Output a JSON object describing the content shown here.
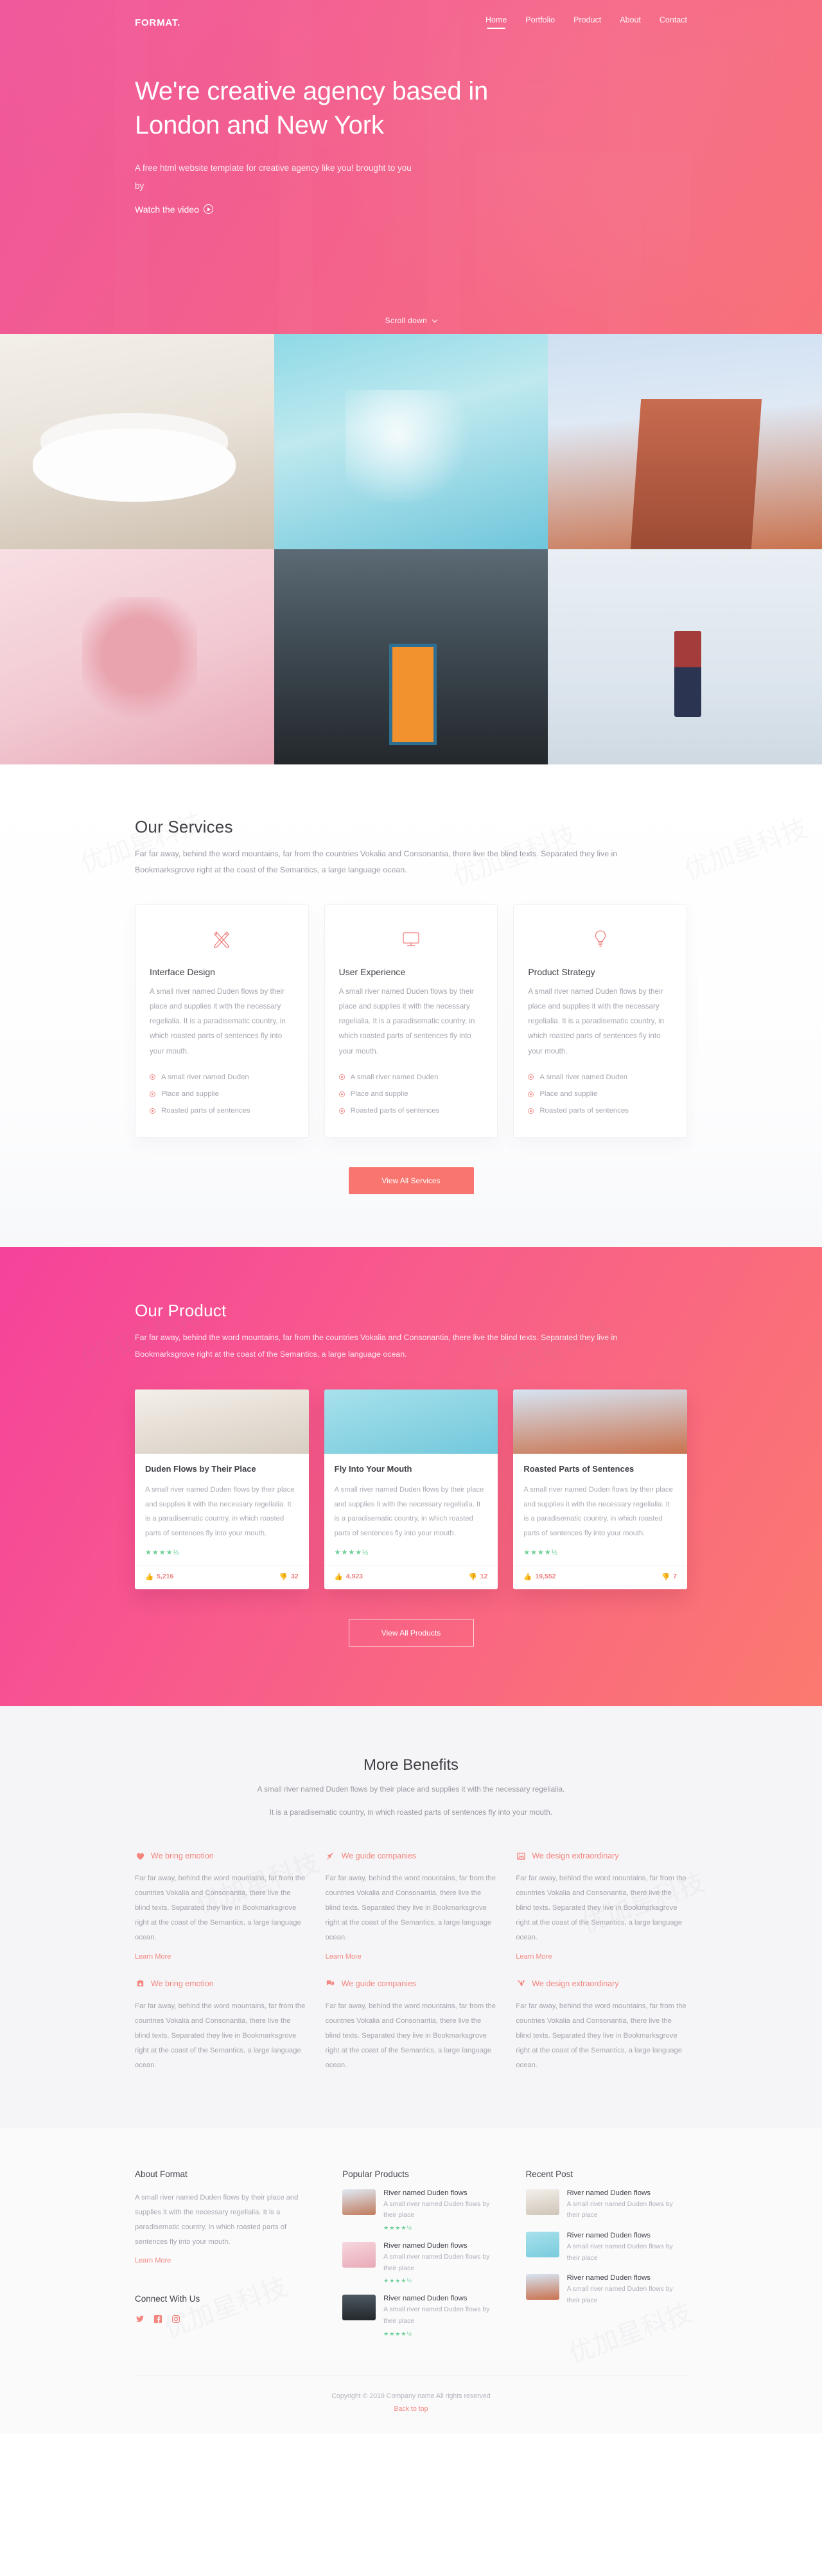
{
  "brand": "FORMAT.",
  "nav": {
    "items": [
      {
        "label": "Home",
        "active": true
      },
      {
        "label": "Portfolio",
        "active": false
      },
      {
        "label": "Product",
        "active": false
      },
      {
        "label": "About",
        "active": false
      },
      {
        "label": "Contact",
        "active": false
      }
    ]
  },
  "hero": {
    "title": "We're creative agency based in London and New York",
    "subtitle": "A free html website template for creative agency like you! brought to you by",
    "watch_label": "Watch the video",
    "scroll_label": "Scroll down"
  },
  "services": {
    "title": "Our Services",
    "lead": "Far far away, behind the word mountains, far from the countries Vokalia and Consonantia, there live the blind texts. Separated they live in Bookmarksgrove right at the coast of the Semantics, a large language ocean.",
    "cards": [
      {
        "icon": "pencil-ruler-icon",
        "title": "Interface Design",
        "body": "A small river named Duden flows by their place and supplies it with the necessary regelialia. It is a paradisematic country, in which roasted parts of sentences fly into your mouth.",
        "items": [
          "A small river named Duden",
          "Place and supplie",
          "Roasted parts of sentences"
        ]
      },
      {
        "icon": "monitor-icon",
        "title": "User Experience",
        "body": "A small river named Duden flows by their place and supplies it with the necessary regelialia. It is a paradisematic country, in which roasted parts of sentences fly into your mouth.",
        "items": [
          "A small river named Duden",
          "Place and supplie",
          "Roasted parts of sentences"
        ]
      },
      {
        "icon": "lightbulb-icon",
        "title": "Product Strategy",
        "body": "A small river named Duden flows by their place and supplies it with the necessary regelialia. It is a paradisematic country, in which roasted parts of sentences fly into your mouth.",
        "items": [
          "A small river named Duden",
          "Place and supplie",
          "Roasted parts of sentences"
        ]
      }
    ],
    "button": "View All Services"
  },
  "product": {
    "title": "Our Product",
    "lead": "Far far away, behind the word mountains, far from the countries Vokalia and Consonantia, there live the blind texts. Separated they live in Bookmarksgrove right at the coast of the Semantics, a large language ocean.",
    "cards": [
      {
        "image": "dining-room-photo",
        "title": "Duden Flows by Their Place",
        "body": "A small river named Duden flows by their place and supplies it with the necessary regelialia. It is a paradisematic country, in which roasted parts of sentences fly into your mouth.",
        "rating": "★★★★½",
        "likes": "5,216",
        "dislikes": "32"
      },
      {
        "image": "swimming-pool-photo",
        "title": "Fly Into Your Mouth",
        "body": "A small river named Duden flows by their place and supplies it with the necessary regelialia. It is a paradisematic country, in which roasted parts of sentences fly into your mouth.",
        "rating": "★★★★½",
        "likes": "4,923",
        "dislikes": "12"
      },
      {
        "image": "brick-building-photo",
        "title": "Roasted Parts of Sentences",
        "body": "A small river named Duden flows by their place and supplies it with the necessary regelialia. It is a paradisematic country, in which roasted parts of sentences fly into your mouth.",
        "rating": "★★★★½",
        "likes": "19,552",
        "dislikes": "7"
      }
    ],
    "button": "View All Products"
  },
  "benefits": {
    "title": "More Benefits",
    "lead_line1": "A small river named Duden flows by their place and supplies it with the necessary regelialia.",
    "lead_line2": "It is a paradisematic country, in which roasted parts of sentences fly into your mouth.",
    "body": "Far far away, behind the word mountains, far from the countries Vokalia and Consonantia, there live the blind texts. Separated they live in Bookmarksgrove right at the coast of the Semantics, a large language ocean.",
    "learn_more": "Learn More",
    "items": [
      {
        "icon": "heart-icon",
        "title": "We bring emotion"
      },
      {
        "icon": "rocket-icon",
        "title": "We guide companies"
      },
      {
        "icon": "image-icon",
        "title": "We design extraordinary"
      },
      {
        "icon": "briefcase-medical-icon",
        "title": "We bring emotion"
      },
      {
        "icon": "chat-bubbles-icon",
        "title": "We guide companies"
      },
      {
        "icon": "shield-icon",
        "title": "We design extraordinary"
      }
    ]
  },
  "footer": {
    "about": {
      "title": "About Format",
      "body": "A small river named Duden flows by their place and supplies it with the necessary regelialia. It is a paradisematic country, in which roasted parts of sentences fly into your mouth.",
      "learn_more": "Learn More"
    },
    "connect": {
      "title": "Connect With Us",
      "socials": [
        {
          "icon": "twitter-icon",
          "label": "Twitter"
        },
        {
          "icon": "facebook-icon",
          "label": "Facebook"
        },
        {
          "icon": "instagram-icon",
          "label": "Instagram"
        }
      ]
    },
    "popular": {
      "title": "Popular Products",
      "items": [
        {
          "image": "brick-building-thumb",
          "title": "River named Duden flows",
          "body": "A small river named Duden flows by their place",
          "rating": "★★★★½"
        },
        {
          "image": "pink-portrait-thumb",
          "title": "River named Duden flows",
          "body": "A small river named Duden flows by their place",
          "rating": "★★★★½"
        },
        {
          "image": "cabin-door-thumb",
          "title": "River named Duden flows",
          "body": "A small river named Duden flows by their place",
          "rating": "★★★★½"
        }
      ]
    },
    "recent": {
      "title": "Recent Post",
      "items": [
        {
          "image": "dining-room-thumb",
          "title": "River named Duden flows",
          "body": "A small river named Duden flows by their place"
        },
        {
          "image": "swimming-pool-thumb",
          "title": "River named Duden flows",
          "body": "A small river named Duden flows by their place"
        },
        {
          "image": "brick-building-thumb",
          "title": "River named Duden flows",
          "body": "A small river named Duden flows by their place"
        }
      ]
    },
    "copyright": "Copyright © 2019 Company name All rights reserved",
    "back_to_top": "Back to top"
  },
  "colors": {
    "accent": "#f8766f",
    "pink": "#f5429b",
    "coral": "#fb7a6f",
    "star_green": "#6fcf97"
  }
}
